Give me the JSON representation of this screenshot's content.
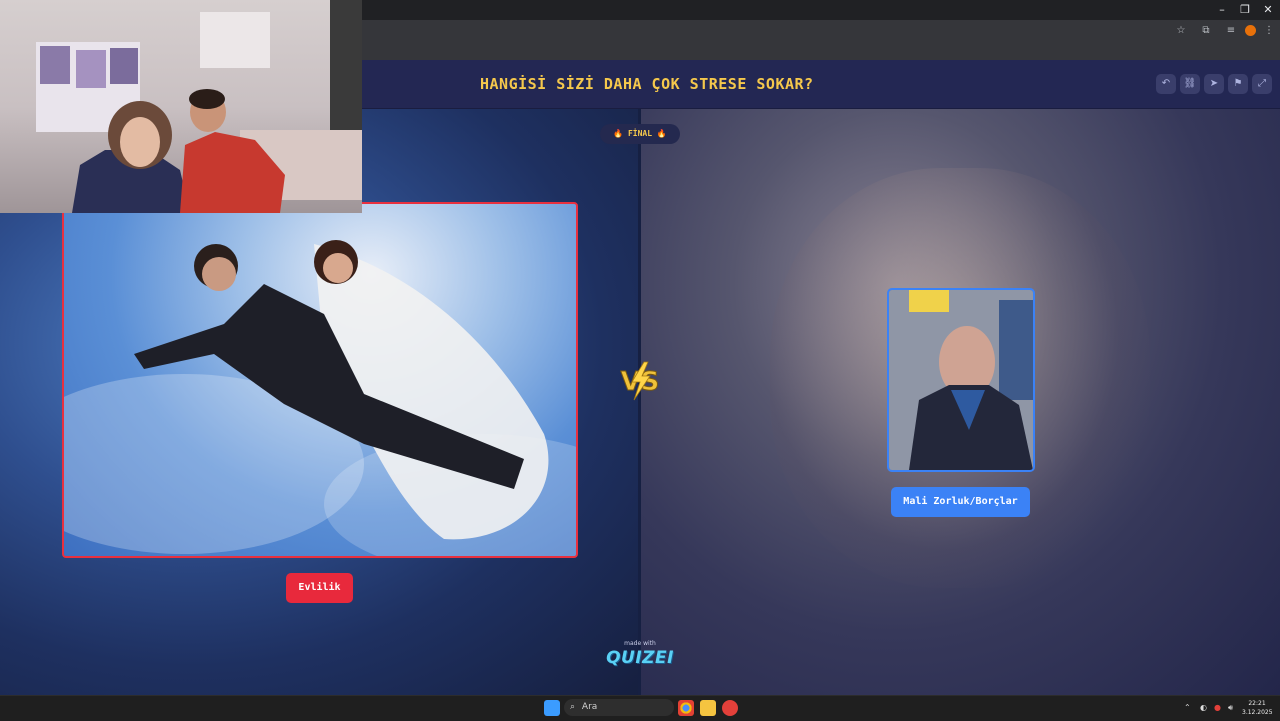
{
  "quiz": {
    "question": "HANGİSİ SİZİ DAHA ÇOK STRESE SOKAR?",
    "round_badge": "🔥 FİNAL 🔥",
    "vs_text": "VS",
    "option_a": {
      "label": "Evlilik",
      "color": "#e8293c"
    },
    "option_b": {
      "label": "Mali Zorluk/Borçlar",
      "color": "#3b82f6"
    },
    "made_with": "made with",
    "brand": "QUIZEI"
  },
  "header_actions": [
    "undo-icon",
    "share-icon",
    "send-icon",
    "flag-icon",
    "fullscreen-icon"
  ],
  "taskbar": {
    "search_placeholder": "Ara",
    "time": "22:21",
    "date": "3.12.2025"
  },
  "colors": {
    "question_text": "#f5c84c",
    "header_bg": "#232753",
    "accent_a": "#e8293c",
    "accent_b": "#3b82f6"
  }
}
